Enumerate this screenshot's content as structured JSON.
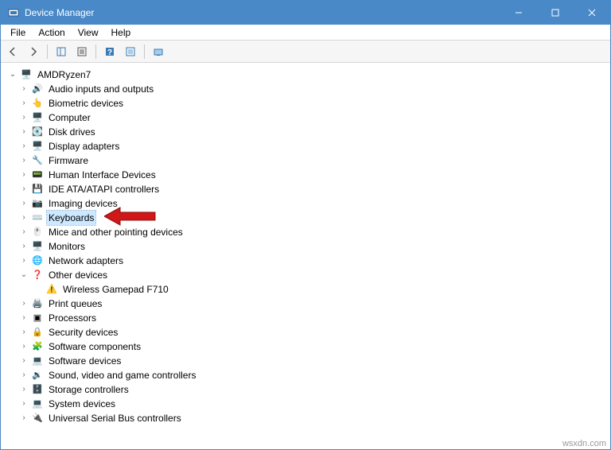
{
  "window": {
    "title": "Device Manager"
  },
  "menu": {
    "file": "File",
    "action": "Action",
    "view": "View",
    "help": "Help"
  },
  "root": {
    "name": "AMDRyzen7"
  },
  "selected": "Keyboards",
  "nodes": [
    {
      "label": "Audio inputs and outputs",
      "icon": "🔊",
      "exp": "›"
    },
    {
      "label": "Biometric devices",
      "icon": "👆",
      "exp": "›"
    },
    {
      "label": "Computer",
      "icon": "🖥️",
      "exp": "›"
    },
    {
      "label": "Disk drives",
      "icon": "💽",
      "exp": "›"
    },
    {
      "label": "Display adapters",
      "icon": "🖥️",
      "exp": "›"
    },
    {
      "label": "Firmware",
      "icon": "🔧",
      "exp": "›"
    },
    {
      "label": "Human Interface Devices",
      "icon": "📟",
      "exp": "›"
    },
    {
      "label": "IDE ATA/ATAPI controllers",
      "icon": "💾",
      "exp": "›"
    },
    {
      "label": "Imaging devices",
      "icon": "📷",
      "exp": "›"
    },
    {
      "label": "Keyboards",
      "icon": "⌨️",
      "exp": "›"
    },
    {
      "label": "Mice and other pointing devices",
      "icon": "🖱️",
      "exp": "›"
    },
    {
      "label": "Monitors",
      "icon": "🖥️",
      "exp": "›"
    },
    {
      "label": "Network adapters",
      "icon": "🌐",
      "exp": "›"
    },
    {
      "label": "Other devices",
      "icon": "❓",
      "exp": "⌄",
      "children": [
        {
          "label": "Wireless Gamepad F710",
          "icon": "⚠️"
        }
      ]
    },
    {
      "label": "Print queues",
      "icon": "🖨️",
      "exp": "›"
    },
    {
      "label": "Processors",
      "icon": "▣",
      "exp": "›"
    },
    {
      "label": "Security devices",
      "icon": "🔒",
      "exp": "›"
    },
    {
      "label": "Software components",
      "icon": "🧩",
      "exp": "›"
    },
    {
      "label": "Software devices",
      "icon": "💻",
      "exp": "›"
    },
    {
      "label": "Sound, video and game controllers",
      "icon": "🔉",
      "exp": "›"
    },
    {
      "label": "Storage controllers",
      "icon": "🗄️",
      "exp": "›"
    },
    {
      "label": "System devices",
      "icon": "💻",
      "exp": "›"
    },
    {
      "label": "Universal Serial Bus controllers",
      "icon": "🔌",
      "exp": "›"
    }
  ],
  "watermark": "wsxdn.com"
}
